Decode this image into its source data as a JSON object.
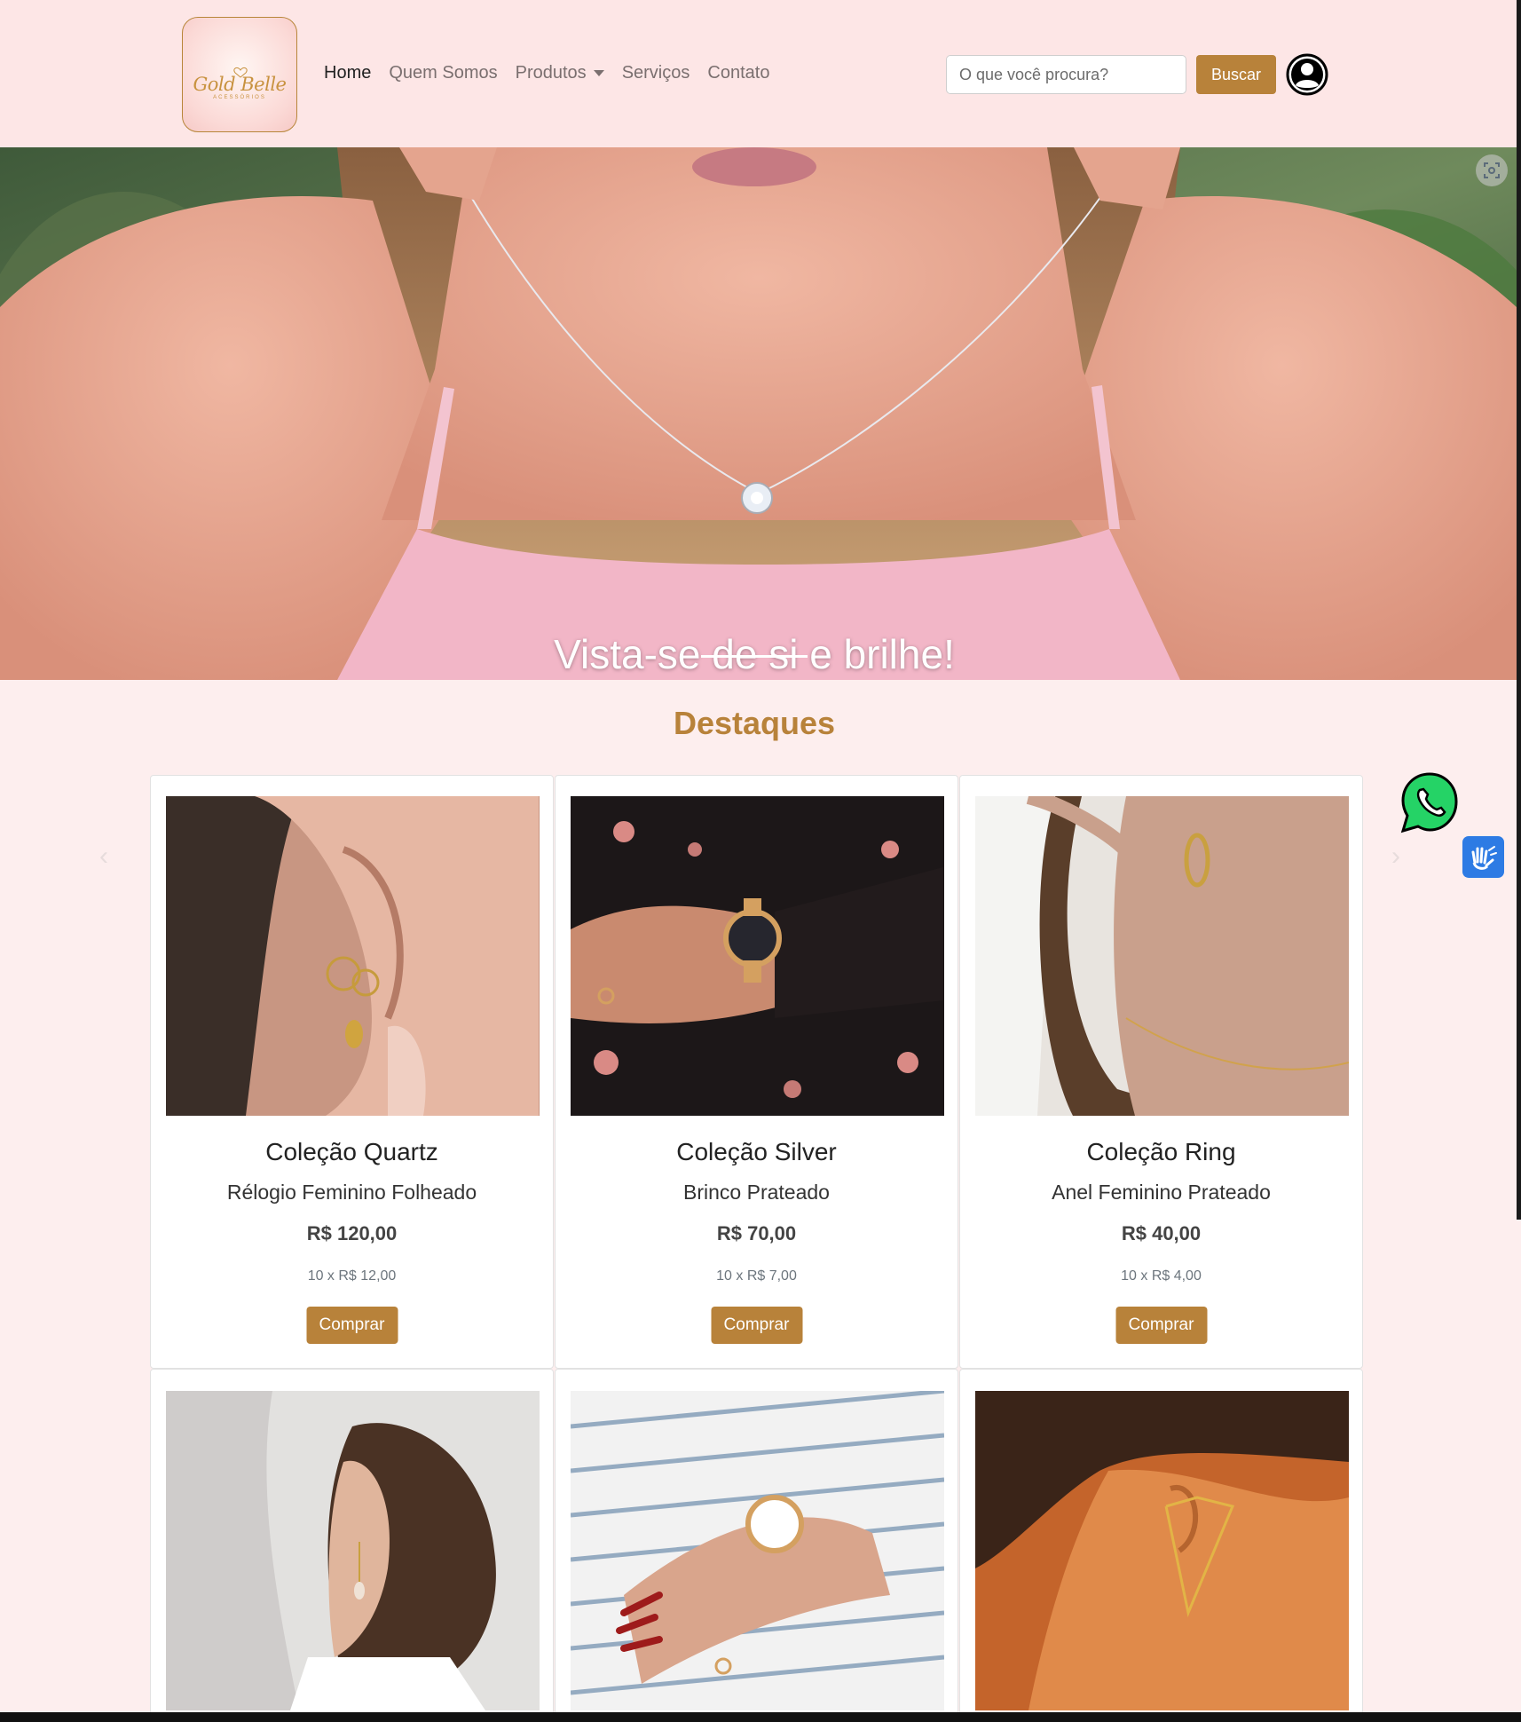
{
  "brand": {
    "logo_name": "Gold Belle",
    "logo_tagline": "ACESSÓRIOS",
    "accent_color": "#b8823a",
    "background_color": "#fdeeee"
  },
  "nav": {
    "items": [
      {
        "label": "Home",
        "active": true
      },
      {
        "label": "Quem Somos",
        "active": false
      },
      {
        "label": "Produtos",
        "active": false,
        "dropdown": true
      },
      {
        "label": "Serviços",
        "active": false
      },
      {
        "label": "Contato",
        "active": false
      }
    ]
  },
  "search": {
    "placeholder": "O que você procura?",
    "value": "",
    "button_label": "Buscar"
  },
  "hero": {
    "caption": "Vista-se de si e brilhe!"
  },
  "featured": {
    "title": "Destaques",
    "products": [
      {
        "collection": "Coleção Quartz",
        "name": "Rélogio Feminino Folheado",
        "price": "R$ 120,00",
        "installments": "10 x R$ 12,00",
        "button": "Comprar"
      },
      {
        "collection": "Coleção Silver",
        "name": "Brinco Prateado",
        "price": "R$ 70,00",
        "installments": "10 x R$ 7,00",
        "button": "Comprar"
      },
      {
        "collection": "Coleção Ring",
        "name": "Anel Feminino Prateado",
        "price": "R$ 40,00",
        "installments": "10 x R$ 4,00",
        "button": "Comprar"
      }
    ]
  },
  "icons": {
    "user": "user-circle-icon",
    "whatsapp": "whatsapp-icon",
    "libras": "sign-language-icon",
    "prev": "chevron-left-icon",
    "next": "chevron-right-icon",
    "screenshot": "screen-capture-icon"
  }
}
